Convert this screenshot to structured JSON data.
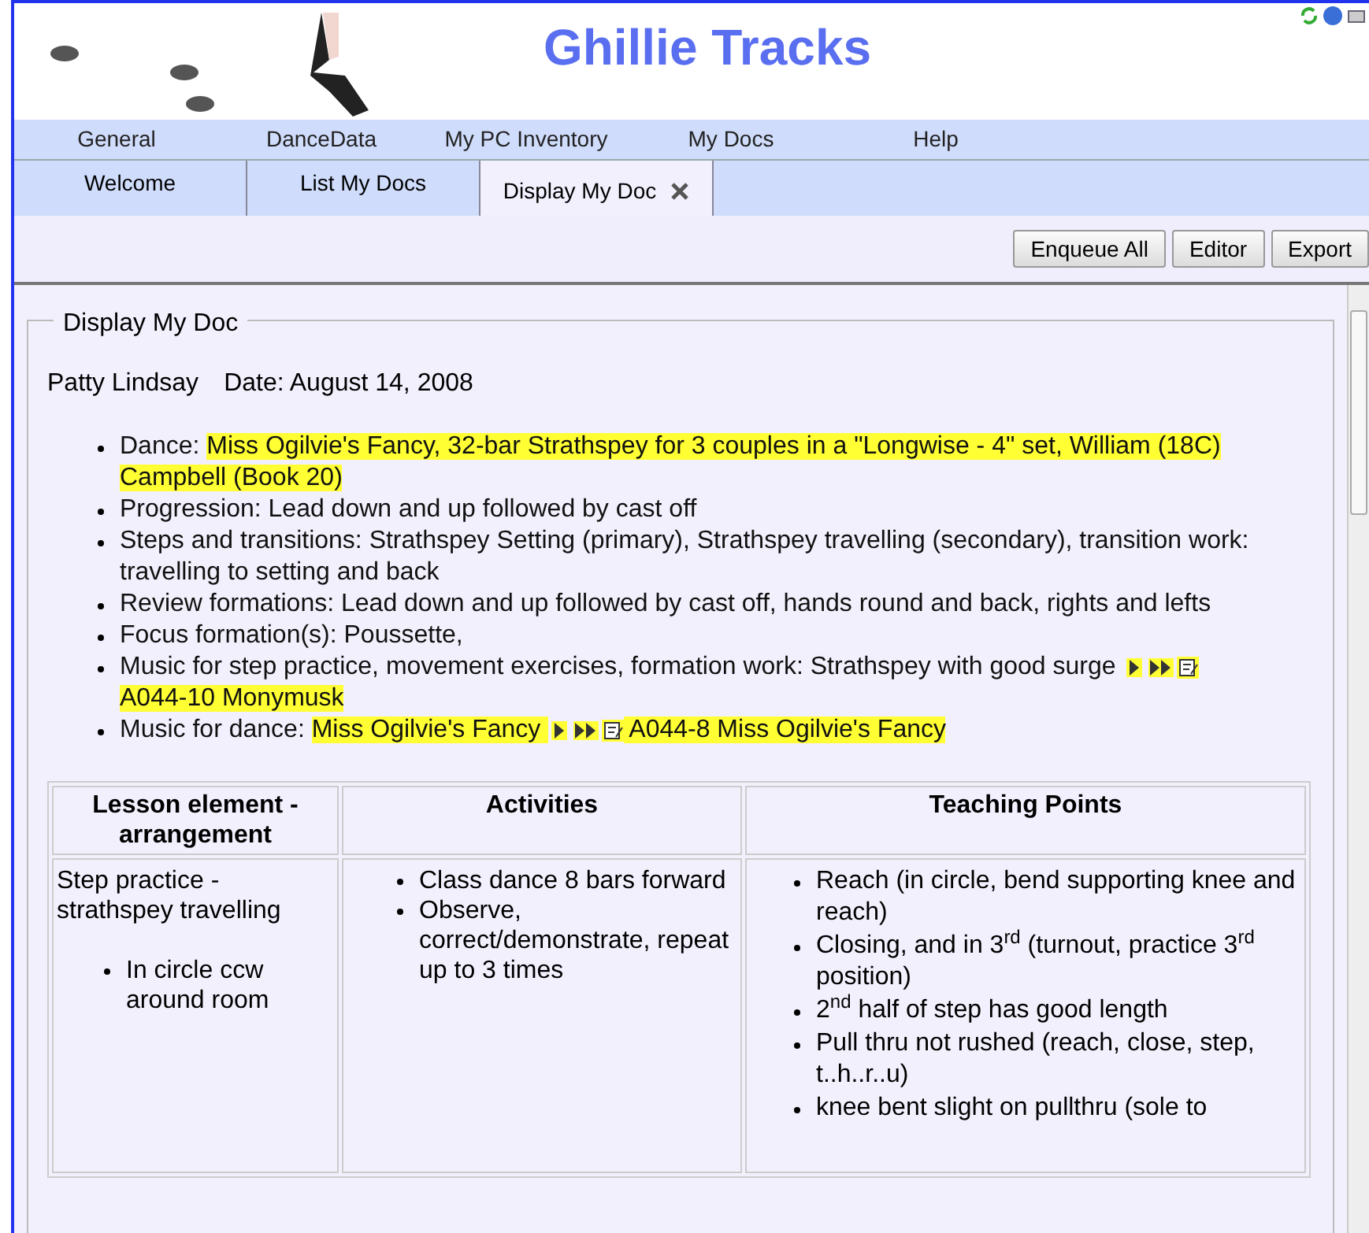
{
  "header": {
    "title": "Ghillie Tracks"
  },
  "menu": [
    "General",
    "DanceData",
    "My PC Inventory",
    "My Docs",
    "Help"
  ],
  "tabs": [
    {
      "label": "Welcome",
      "selected": false,
      "closable": false
    },
    {
      "label": "List My Docs",
      "selected": false,
      "closable": false
    },
    {
      "label": "Display My Doc",
      "selected": true,
      "closable": true
    }
  ],
  "toolbar": [
    "Enqueue All",
    "Editor",
    "Export"
  ],
  "panel": {
    "legend": "Display My Doc",
    "author": "Patty Lindsay",
    "date": "Date: August 14, 2008",
    "bullets": [
      {
        "segments": [
          {
            "kind": "text",
            "text": "Dance: ",
            "highlighted": false
          },
          {
            "kind": "text",
            "text": "Miss Ogilvie's Fancy, 32-bar Strathspey for 3 couples in a \"Longwise - 4\" set, William (18C) Campbell (Book 20) ",
            "highlighted": true
          }
        ]
      },
      {
        "segments": [
          {
            "kind": "text",
            "text": "Progression:  Lead down and up followed by cast off",
            "highlighted": false
          }
        ]
      },
      {
        "segments": [
          {
            "kind": "text",
            "text": "Steps and transitions: Strathspey Setting (primary), Strathspey travelling (secondary), transition work: travelling to setting and back",
            "highlighted": false
          }
        ]
      },
      {
        "segments": [
          {
            "kind": "text",
            "text": "Review formations: Lead down and up followed by cast off, hands round and back, rights and lefts",
            "highlighted": false
          }
        ]
      },
      {
        "segments": [
          {
            "kind": "text",
            "text": "Focus formation(s):  Poussette,",
            "highlighted": false
          }
        ]
      },
      {
        "segments": [
          {
            "kind": "text",
            "text": "Music for step practice, movement exercises, formation work: Strathspey with good surge ",
            "highlighted": false
          },
          {
            "kind": "play",
            "highlighted": true
          },
          {
            "kind": "fast",
            "highlighted": true
          },
          {
            "kind": "note",
            "highlighted": true
          },
          {
            "kind": "text",
            "text": " A044-10 Monymusk ",
            "highlighted": true
          }
        ]
      },
      {
        "segments": [
          {
            "kind": "text",
            "text": "Music for dance: ",
            "highlighted": false
          },
          {
            "kind": "text",
            "text": "Miss Ogilvie's Fancy ",
            "highlighted": true
          },
          {
            "kind": "play",
            "highlighted": true
          },
          {
            "kind": "fast",
            "highlighted": true
          },
          {
            "kind": "note",
            "highlighted": true
          },
          {
            "kind": "text",
            "text": " A044-8 Miss Ogilvie's Fancy ",
            "highlighted": true
          }
        ]
      }
    ],
    "table": {
      "columns": [
        "Lesson element - arrangement",
        "Activities",
        "Teaching Points"
      ],
      "rows": [
        {
          "lesson": "Step practice - strathspey travelling",
          "lesson_items": [
            "In circle ccw around room"
          ],
          "activities": [
            "Class dance  8 bars forward",
            "Observe, correct/demonstrate, repeat up to 3 times"
          ],
          "points": [
            "Reach (in circle, bend supporting knee and reach)",
            "Closing, and in 3$^{rd}$ (turnout, practice 3$^{rd}$ position)",
            "2$^{nd}$ half of step has good length",
            "Pull thru not rushed (reach, close, step, t..h..r..u)",
            "knee bent slight on pullthru (sole to"
          ]
        }
      ]
    }
  }
}
